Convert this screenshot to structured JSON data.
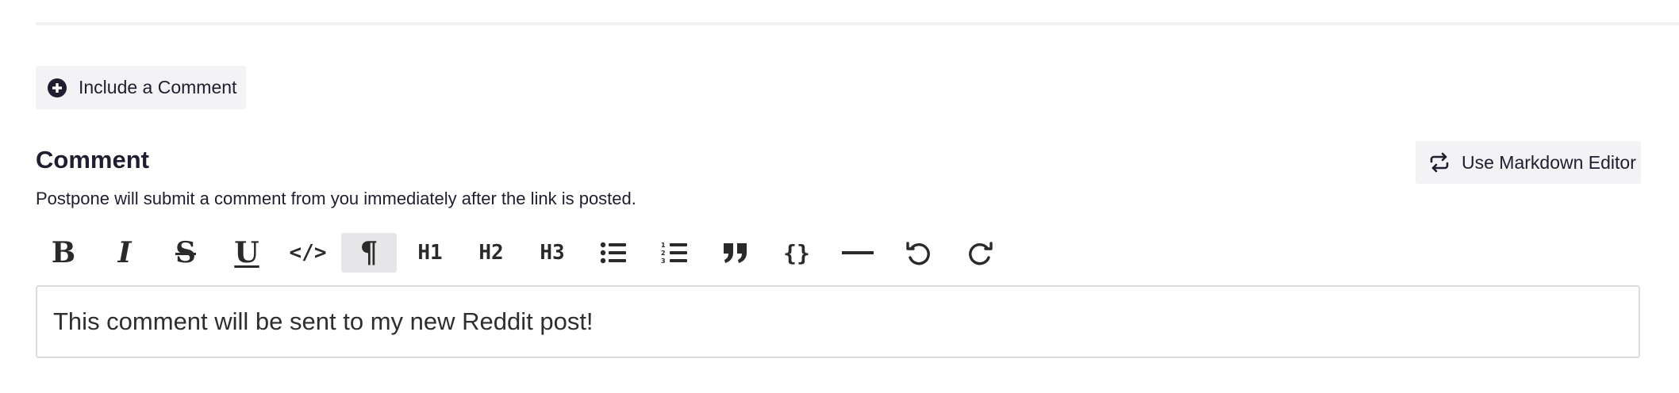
{
  "include_comment": {
    "label": "Include a Comment",
    "icon": "plus-circle-icon"
  },
  "comment_section": {
    "title": "Comment",
    "description": "Postpone will submit a comment from you immediately after the link is posted."
  },
  "markdown_toggle": {
    "label": "Use Markdown Editor",
    "icon": "swap-icon"
  },
  "toolbar": {
    "buttons": [
      {
        "name": "bold",
        "icon": "bold-icon",
        "text": "B",
        "active": false
      },
      {
        "name": "italic",
        "icon": "italic-icon",
        "text": "I",
        "active": false
      },
      {
        "name": "strikethrough",
        "icon": "strikethrough-icon",
        "text": "S",
        "active": false
      },
      {
        "name": "underline",
        "icon": "underline-icon",
        "text": "U",
        "active": false
      },
      {
        "name": "code",
        "icon": "code-icon",
        "text": "</>",
        "active": false
      },
      {
        "name": "paragraph",
        "icon": "paragraph-icon",
        "text": "¶",
        "active": true
      },
      {
        "name": "heading-1",
        "icon": "heading-1-icon",
        "text": "H1",
        "active": false
      },
      {
        "name": "heading-2",
        "icon": "heading-2-icon",
        "text": "H2",
        "active": false
      },
      {
        "name": "heading-3",
        "icon": "heading-3-icon",
        "text": "H3",
        "active": false
      },
      {
        "name": "bullet-list",
        "icon": "bullet-list-icon",
        "active": false
      },
      {
        "name": "ordered-list",
        "icon": "ordered-list-icon",
        "active": false
      },
      {
        "name": "blockquote",
        "icon": "quote-icon",
        "active": false
      },
      {
        "name": "code-block",
        "icon": "braces-icon",
        "text": "{}",
        "active": false
      },
      {
        "name": "horizontal-rule",
        "icon": "horizontal-rule-icon",
        "active": false
      },
      {
        "name": "undo",
        "icon": "undo-icon",
        "active": false
      },
      {
        "name": "redo",
        "icon": "redo-icon",
        "active": false
      }
    ]
  },
  "editor": {
    "content": "This comment will be sent to my new Reddit post!"
  },
  "colors": {
    "text": "#1e1e30",
    "button_bg": "#f3f3f5",
    "active_bg": "#e6e6e8",
    "border": "#dcdcde"
  }
}
